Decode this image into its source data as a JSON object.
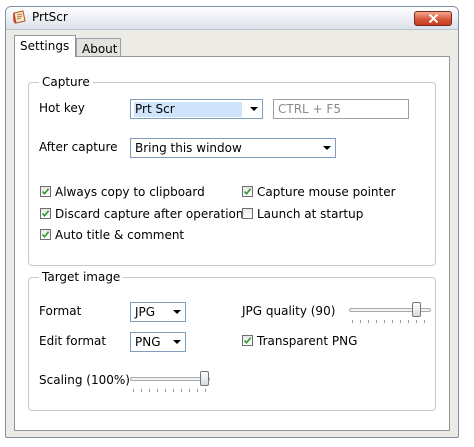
{
  "window": {
    "title": "PrtScr",
    "icons": {
      "app": "paper-scroll-icon",
      "close": "close-icon"
    },
    "colors": {
      "close_button": "#d9573b",
      "selection": "#cfe4fb"
    }
  },
  "tabs": [
    {
      "label": "Settings",
      "active": true
    },
    {
      "label": "About",
      "active": false
    }
  ],
  "capture": {
    "group_title": "Capture",
    "hotkey": {
      "label": "Hot key",
      "value": "Prt Scr",
      "alt_value": "CTRL + F5"
    },
    "after_capture": {
      "label": "After capture",
      "value": "Bring this window"
    },
    "checkboxes": {
      "always_copy": {
        "label": "Always copy to clipboard",
        "checked": true
      },
      "capture_pointer": {
        "label": "Capture mouse pointer",
        "checked": true
      },
      "discard_after": {
        "label": "Discard capture after operation",
        "checked": true
      },
      "launch_startup": {
        "label": "Launch at startup",
        "checked": false
      },
      "auto_title": {
        "label": "Auto title & comment",
        "checked": true
      }
    }
  },
  "target": {
    "group_title": "Target image",
    "format": {
      "label": "Format",
      "value": "JPG"
    },
    "jpg_quality": {
      "label": "JPG quality (90)",
      "value": 90
    },
    "edit_format": {
      "label": "Edit format",
      "value": "PNG"
    },
    "transparent_png": {
      "label": "Transparent PNG",
      "checked": true
    },
    "scaling": {
      "label": "Scaling (100%)",
      "value": 100
    }
  }
}
